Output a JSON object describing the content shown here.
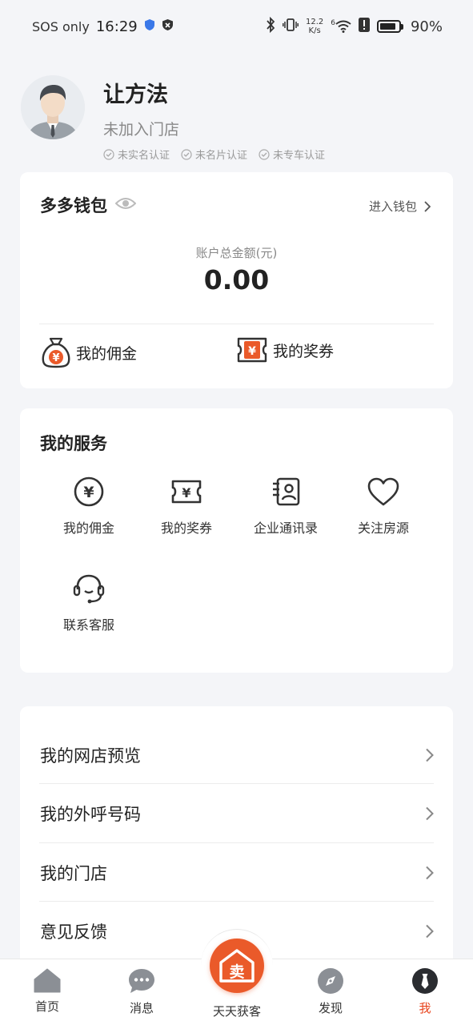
{
  "status_bar": {
    "carrier": "SOS only",
    "time": "16:29",
    "net_speed_value": "12.2",
    "net_speed_unit": "K/s",
    "signal_label": "6",
    "battery_percent": "90%",
    "battery_level": 0.9
  },
  "profile": {
    "name": "让方法",
    "store": "未加入门店",
    "badges": [
      "未实名认证",
      "未名片认证",
      "未专车认证"
    ]
  },
  "wallet": {
    "title": "多多钱包",
    "enter_label": "进入钱包",
    "balance_label": "账户总金额(元)",
    "balance_value": "0.00",
    "links": [
      "我的佣金",
      "我的奖券"
    ]
  },
  "services": {
    "title": "我的服务",
    "items": [
      {
        "label": "我的佣金",
        "icon": "yen-circle-icon"
      },
      {
        "label": "我的奖券",
        "icon": "ticket-icon"
      },
      {
        "label": "企业通讯录",
        "icon": "contacts-icon"
      },
      {
        "label": "关注房源",
        "icon": "heart-icon"
      },
      {
        "label": "联系客服",
        "icon": "headset-icon"
      }
    ]
  },
  "menu": {
    "items": [
      "我的网店预览",
      "我的外呼号码",
      "我的门店",
      "意见反馈"
    ]
  },
  "tabbar": {
    "items": [
      "首页",
      "消息",
      "天天获客",
      "发现",
      "我"
    ],
    "center_glyph": "卖",
    "active_index": 4
  },
  "colors": {
    "accent": "#ea5a2a",
    "active_tab": "#e8431c",
    "background": "#f4f5f8"
  }
}
